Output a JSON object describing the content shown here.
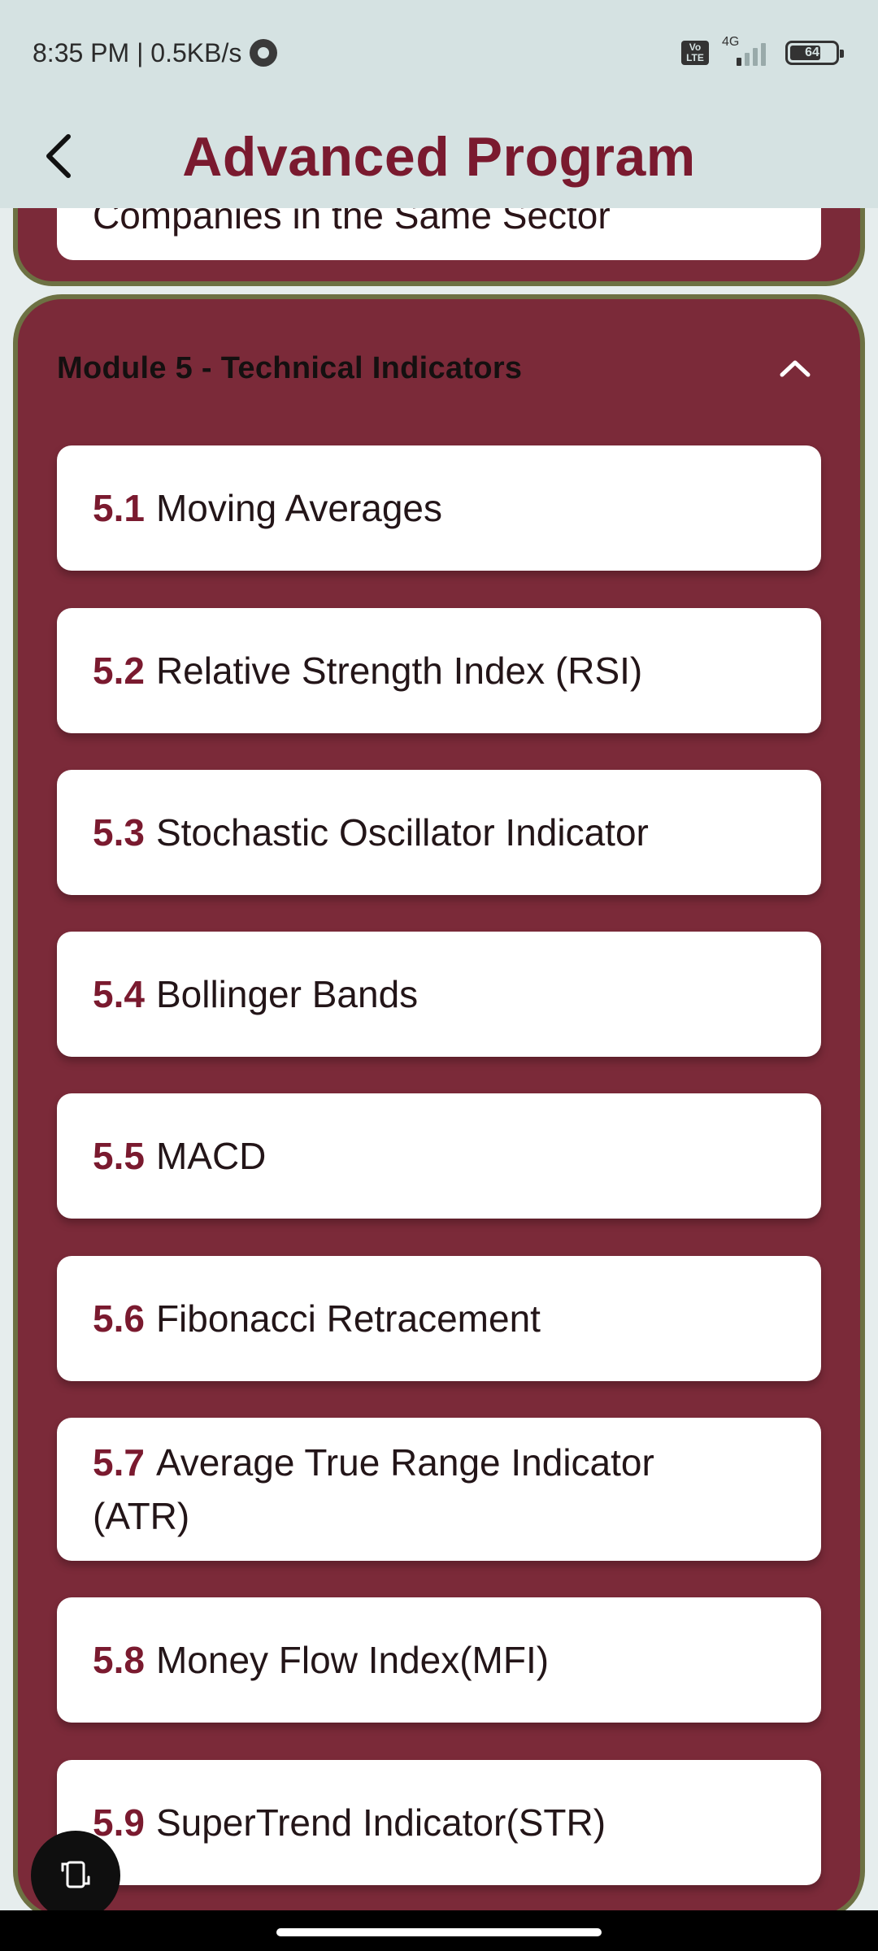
{
  "status": {
    "time_speed": "8:35 PM | 0.5KB/s",
    "volte": "Vo LTE",
    "network": "4G",
    "battery": "64",
    "battery_fraction": 0.64
  },
  "header": {
    "title": "Advanced Program",
    "back_icon": "chevron-left-icon"
  },
  "previous_module": {
    "last_item": "Companies in the Same Sector"
  },
  "module": {
    "title": "Module 5 - Technical Indicators",
    "toggle_icon": "chevron-up-icon",
    "lessons": [
      {
        "num": "5.1",
        "label": "Moving Averages"
      },
      {
        "num": "5.2",
        "label": "Relative Strength Index (RSI)"
      },
      {
        "num": "5.3",
        "label": "Stochastic Oscillator Indicator"
      },
      {
        "num": "5.4",
        "label": "Bollinger Bands"
      },
      {
        "num": "5.5",
        "label": "MACD"
      },
      {
        "num": "5.6",
        "label": "Fibonacci Retracement"
      },
      {
        "num": "5.7",
        "label": "Average True Range Indicator (ATR)"
      },
      {
        "num": "5.8",
        "label": "Money Flow Index(MFI)"
      },
      {
        "num": "5.9",
        "label": "SuperTrend Indicator(STR)"
      }
    ]
  },
  "fab_icon": "screen-rotate-icon",
  "colors": {
    "brand": "#7a1a2f",
    "card": "#7b2a39",
    "border": "#6d7143",
    "header_bg": "#d5e2e2"
  }
}
